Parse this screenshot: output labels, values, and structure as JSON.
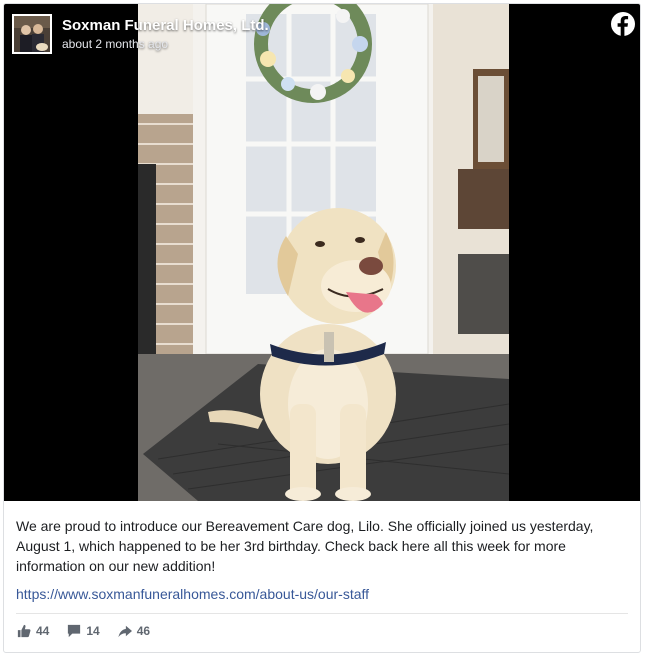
{
  "post": {
    "page_name": "Soxman Funeral Homes, Ltd.",
    "time": "about 2 months ago",
    "message": "We are proud to introduce our Bereavement Care dog, Lilo. She officially joined us yesterday, August 1, which happened to be her 3rd birthday. Check back here all this week for more information on our new addition!",
    "link": "https://www.soxmanfuneralhomes.com/about-us/our-staff"
  },
  "icons": {
    "platform": "facebook-icon",
    "like": "thumbs-up-icon",
    "comment": "comment-icon",
    "share": "share-arrow-icon"
  },
  "stats": {
    "likes": "44",
    "comments": "14",
    "shares": "46"
  },
  "colors": {
    "link": "#385898",
    "text": "#1c1e21",
    "muted": "#606770",
    "border": "#dddfe2"
  }
}
